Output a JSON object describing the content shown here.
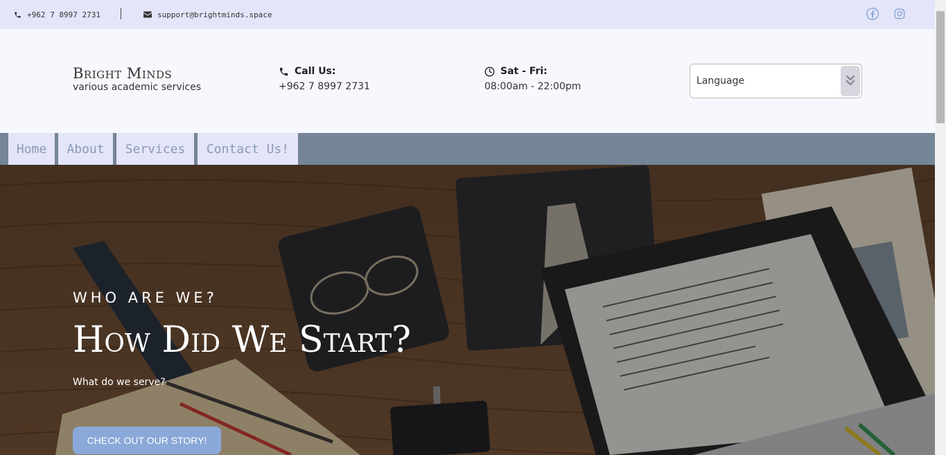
{
  "topbar": {
    "phone": "+962 7 8997 2731",
    "email": "support@brightminds.space",
    "phone_icon": "phone-icon",
    "email_icon": "envelope-icon",
    "social": [
      "facebook-icon",
      "instagram-icon"
    ]
  },
  "header": {
    "brand_title": "Bright Minds",
    "brand_subtitle": "various academic services",
    "call_label": "Call Us:",
    "call_value": "+962 7 8997 2731",
    "hours_label": "Sat - Fri:",
    "hours_value": "08:00am - 22:00pm",
    "language_placeholder": "Language"
  },
  "nav": {
    "items": [
      {
        "label": "Home"
      },
      {
        "label": "About"
      },
      {
        "label": "Services"
      },
      {
        "label": "Contact Us!"
      }
    ]
  },
  "hero": {
    "eyebrow": "WHO ARE WE?",
    "title": "How Did We Start?",
    "subtitle": "What do we serve?",
    "button": "CHECK OUT OUR STORY!"
  },
  "colors": {
    "topbar_bg": "#e4e5f8",
    "nav_bg": "#748597",
    "nav_text": "#8c9ab6",
    "button_bg": "#8aa8d8",
    "social_icon": "#8aa8d8"
  }
}
